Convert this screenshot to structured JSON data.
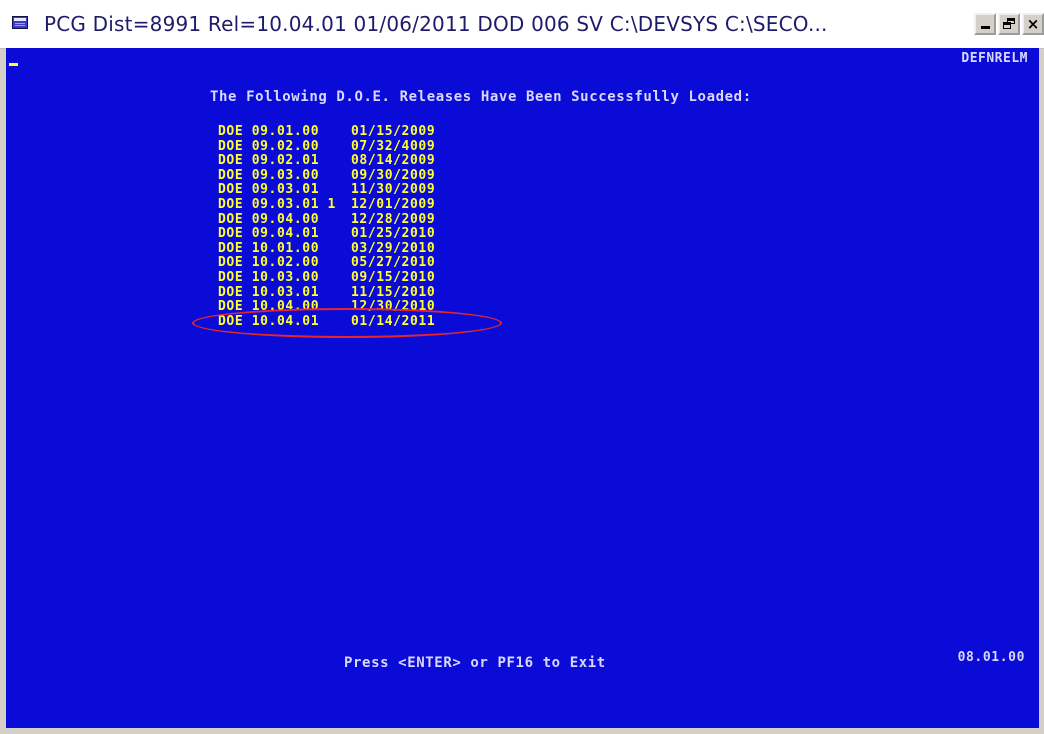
{
  "window": {
    "title": "PCG Dist=8991  Rel=10.04.01  01/06/2011  DOD 006  SV  C:\\DEVSYS   C:\\SECO...",
    "icon": "terminal-app-icon",
    "controls": {
      "minimize": "_",
      "maximize": "restore-icon",
      "close": "×"
    }
  },
  "terminal": {
    "screen_id": "DEFNRELM",
    "heading": "The Following D.O.E. Releases Have Been Successfully Loaded:",
    "releases": [
      {
        "release": "DOE 09.01.00",
        "date": "01/15/2009"
      },
      {
        "release": "DOE 09.02.00",
        "date": "07/32/4009"
      },
      {
        "release": "DOE 09.02.01",
        "date": "08/14/2009"
      },
      {
        "release": "DOE 09.03.00",
        "date": "09/30/2009"
      },
      {
        "release": "DOE 09.03.01",
        "date": "11/30/2009"
      },
      {
        "release": "DOE 09.03.01 1",
        "date": "12/01/2009"
      },
      {
        "release": "DOE 09.04.00",
        "date": "12/28/2009"
      },
      {
        "release": "DOE 09.04.01",
        "date": "01/25/2010"
      },
      {
        "release": "DOE 10.01.00",
        "date": "03/29/2010"
      },
      {
        "release": "DOE 10.02.00",
        "date": "05/27/2010"
      },
      {
        "release": "DOE 10.03.00",
        "date": "09/15/2010"
      },
      {
        "release": "DOE 10.03.01",
        "date": "11/15/2010"
      },
      {
        "release": "DOE 10.04.00",
        "date": "12/30/2010"
      },
      {
        "release": "DOE 10.04.01",
        "date": "01/14/2011"
      }
    ],
    "highlighted_index": 13,
    "exit_prompt": "Press <ENTER> or PF16 to Exit",
    "version": "08.01.00"
  },
  "colors": {
    "screen_bg": "#0b0bd8",
    "release_text": "#ffff33",
    "label_text": "#d8d8ff",
    "highlight": "#e8262a"
  }
}
